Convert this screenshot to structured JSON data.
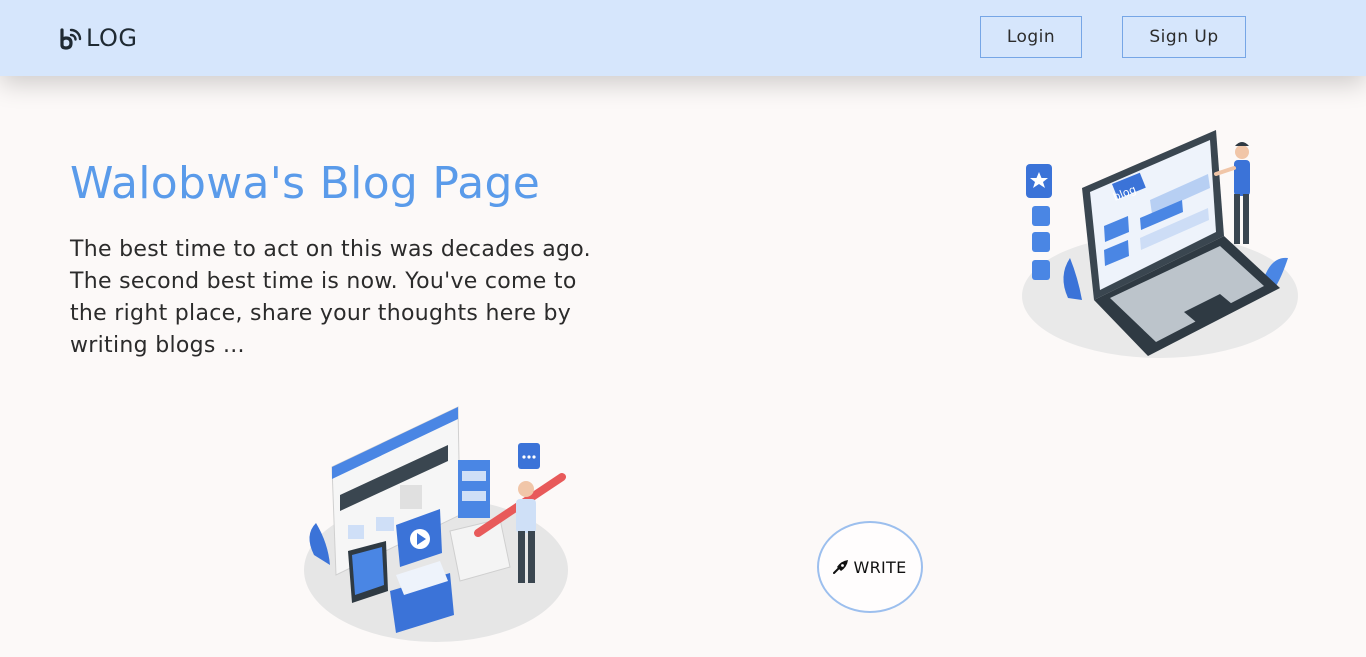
{
  "header": {
    "logo_text": "LOG",
    "login_label": "Login",
    "signup_label": "Sign Up"
  },
  "hero": {
    "title": "Walobwa's Blog Page",
    "tagline": "The best time to act on this was decades ago. The second best time is now. You've come to the right place, share your thoughts here by writing blogs ..."
  },
  "illustrations": {
    "laptop_screen_text": "blog"
  },
  "write_button": {
    "label": "WRITE",
    "icon": "pen-nib-icon"
  },
  "colors": {
    "navbar_bg": "#d6e6fc",
    "accent": "#5a9bea",
    "button_border": "#76a6e6",
    "page_bg": "#fcf9f8"
  }
}
